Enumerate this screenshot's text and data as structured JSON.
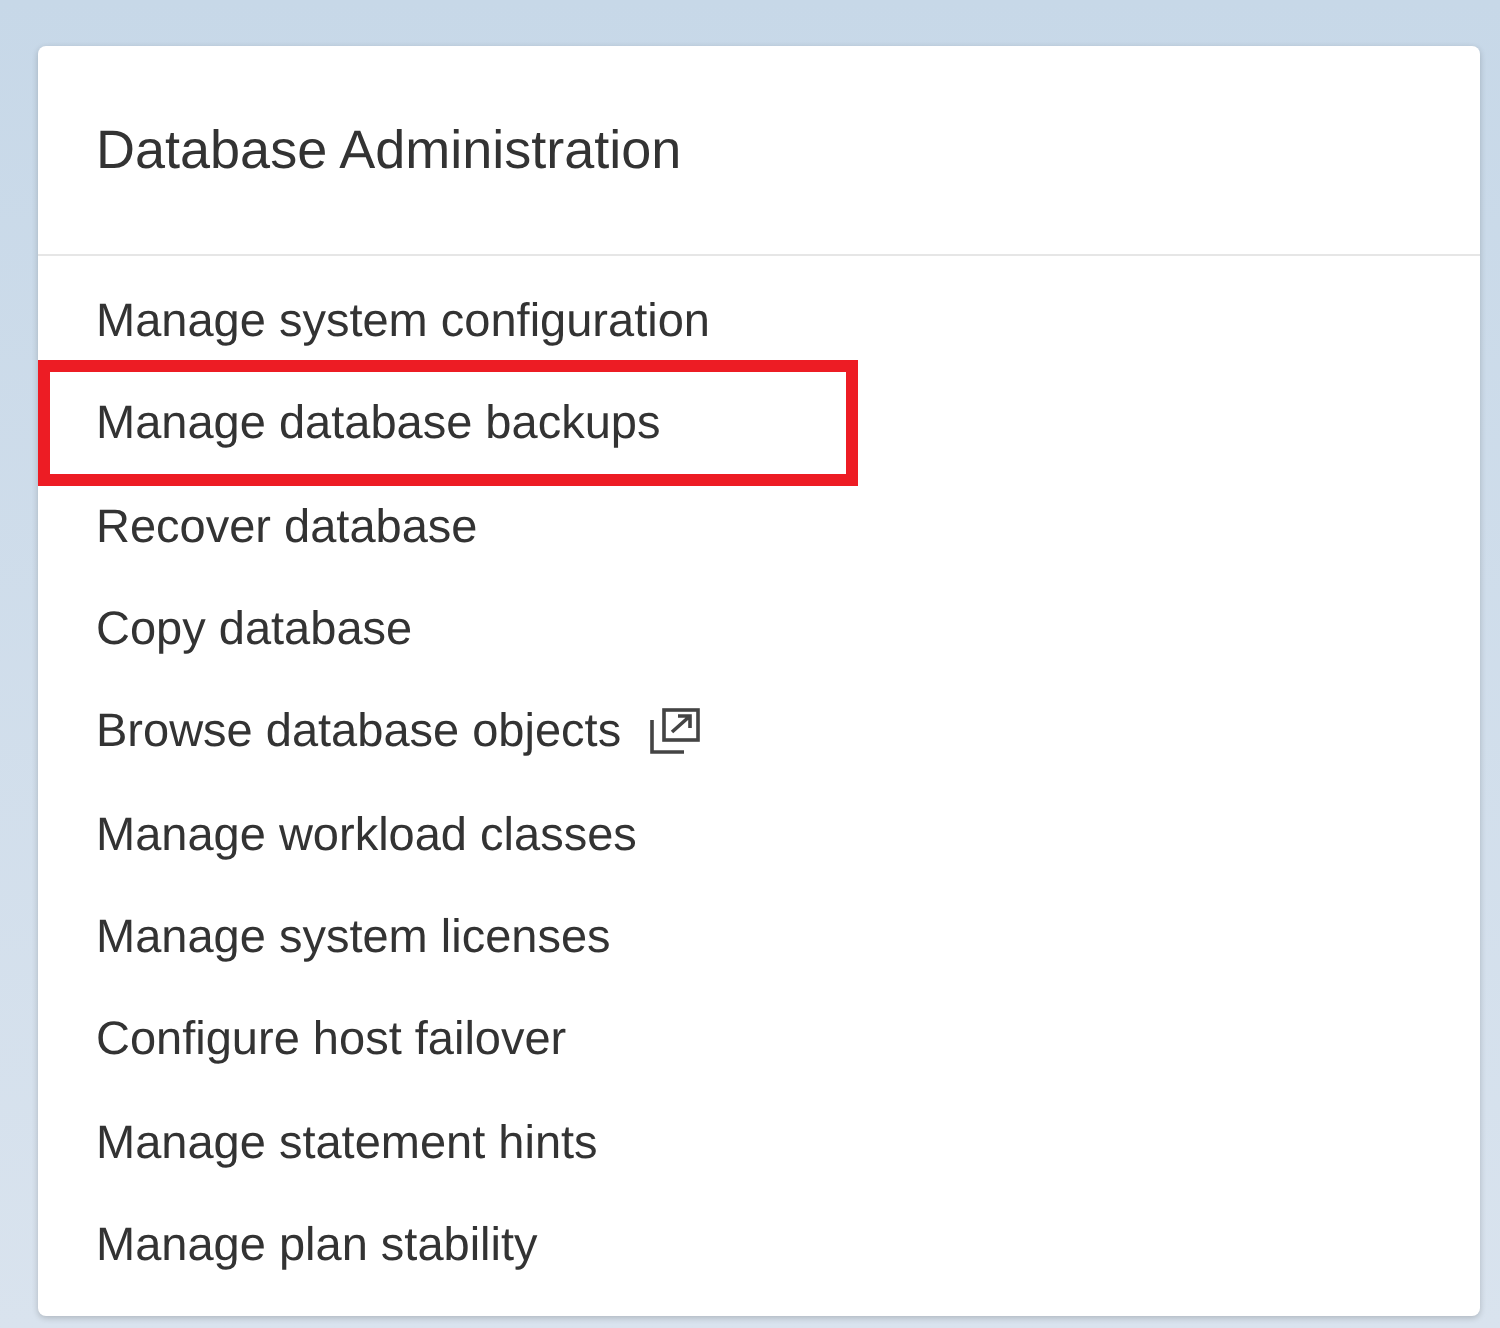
{
  "card": {
    "title": "Database Administration"
  },
  "items": [
    {
      "label": "Manage system configuration",
      "highlighted": false,
      "external": false
    },
    {
      "label": "Manage database backups",
      "highlighted": true,
      "external": false
    },
    {
      "label": "Recover database",
      "highlighted": false,
      "external": false
    },
    {
      "label": "Copy database",
      "highlighted": false,
      "external": false
    },
    {
      "label": "Browse database objects",
      "highlighted": false,
      "external": true
    },
    {
      "label": "Manage workload classes",
      "highlighted": false,
      "external": false
    },
    {
      "label": "Manage system licenses",
      "highlighted": false,
      "external": false
    },
    {
      "label": "Configure host failover",
      "highlighted": false,
      "external": false
    },
    {
      "label": "Manage statement hints",
      "highlighted": false,
      "external": false
    },
    {
      "label": "Manage plan stability",
      "highlighted": false,
      "external": false
    }
  ]
}
